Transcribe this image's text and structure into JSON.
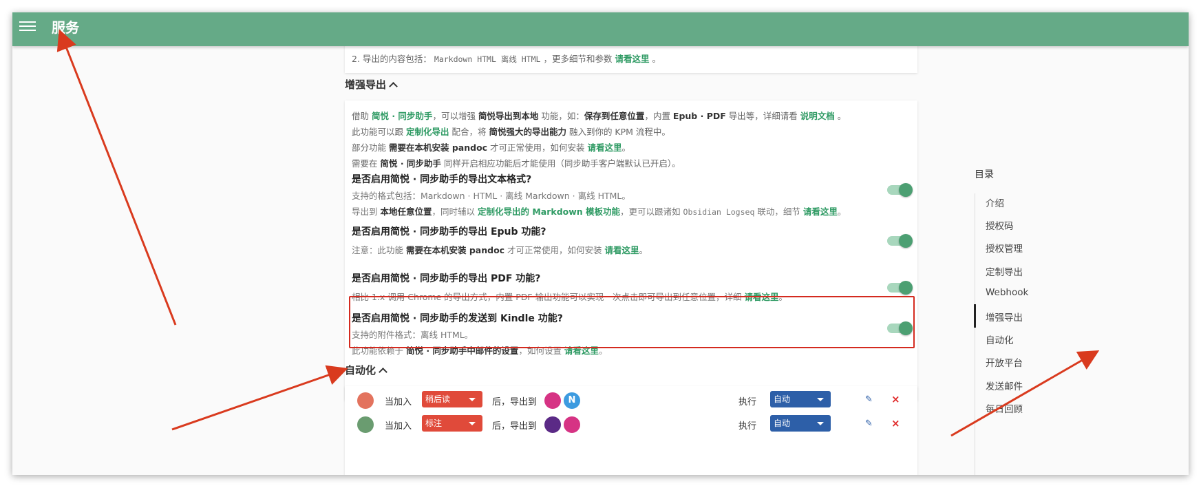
{
  "appbar": {
    "title": "服务"
  },
  "top_card": {
    "line": {
      "prefix": "2. 导出的内容包括：",
      "code": "Markdown HTML 离线 HTML",
      "mid": "，更多细节和参数",
      "link": "请看这里",
      "end": "。"
    }
  },
  "enhanced_export": {
    "heading": "增强导出",
    "notes": [
      {
        "a": "借助 ",
        "l1": "简悦 · 同步助手",
        "b": "，可以增强 ",
        "k1": "简悦导出到本地",
        "c": " 功能，如：",
        "k2": "保存到任意位置",
        "d": "，内置 ",
        "k3": "Epub · PDF",
        "e": " 导出等，详细请看 ",
        "l2": "说明文档",
        "f": " 。"
      },
      {
        "a": "此功能可以跟 ",
        "l1": "定制化导出",
        "b": " 配合，将 ",
        "k1": "简悦强大的导出能力",
        "c": " 融入到你的 KPM 流程中。"
      },
      {
        "a": "部分功能 ",
        "k1": "需要在本机安装 pandoc",
        "b": " 才可正常使用，如何安装 ",
        "l1": "请看这里",
        "c": "。"
      },
      {
        "a": "需要在 ",
        "k1": "简悦 · 同步助手",
        "b": " 同样开启相应功能后才能使用（同步助手客户端默认已开启）。"
      }
    ],
    "options": [
      {
        "title": "是否启用简悦 · 同步助手的导出文本格式?",
        "desc1": "支持的格式包括：Markdown · HTML · 离线 Markdown · 离线 HTML。",
        "desc2": {
          "a": "导出到 ",
          "k1": "本地任意位置",
          "b": "，同时辅以 ",
          "l1": "定制化导出的 Markdown 模板功能",
          "c": "，更可以跟诸如 ",
          "code": "Obsidian Logseq",
          "d": " 联动，细节 ",
          "l2": "请看这里",
          "e": "。"
        },
        "enabled": true
      },
      {
        "title": "是否启用简悦 · 同步助手的导出 Epub 功能?",
        "desc": {
          "a": "注意：此功能 ",
          "k1": "需要在本机安装 pandoc",
          "b": " 才可正常使用，如何安装 ",
          "l1": "请看这里",
          "c": "。"
        },
        "enabled": true
      },
      {
        "title": "是否启用简悦 · 同步助手的导出 PDF 功能?",
        "desc": {
          "a": "相比 1.x 调用 Chrome 的导出方式，内置 PDF 输出功能可以实现一次点击即可导出到任意位置，详细 ",
          "l1": "请看这里",
          "b": "。"
        },
        "enabled": true
      },
      {
        "title": "是否启用简悦 · 同步助手的发送到 Kindle 功能?",
        "desc1": "支持的附件格式：离线 HTML。",
        "desc2": {
          "a": "此功能依赖于 ",
          "k1": "简悦 · 同步助手中邮件的设置",
          "b": "，如何设置 ",
          "l1": "请看这里",
          "c": "。"
        },
        "enabled": true
      }
    ]
  },
  "automation": {
    "heading": "自动化",
    "rows": [
      {
        "when": "当加入",
        "trigger": "稍后读",
        "after": "后，导出到",
        "exec": "执行",
        "mode": "自动",
        "icon_color": "#e3735e",
        "trigger_color": "#e04a3a",
        "services": [
          {
            "label": "",
            "color": "#d63384"
          },
          {
            "label": "N",
            "color": "#3d9be0"
          }
        ]
      },
      {
        "when": "当加入",
        "trigger": "标注",
        "after": "后，导出到",
        "exec": "执行",
        "mode": "自动",
        "icon_color": "#6a9c70",
        "trigger_color": "#e04a3a",
        "services": [
          {
            "label": "",
            "color": "#5b2a86"
          },
          {
            "label": "",
            "color": "#d63384"
          }
        ]
      }
    ]
  },
  "toc": {
    "title": "目录",
    "items": [
      "介绍",
      "授权码",
      "授权管理",
      "定制导出",
      "Webhook",
      "增强导出",
      "自动化",
      "开放平台",
      "发送邮件",
      "每日回顾"
    ],
    "active": "增强导出"
  },
  "colors": {
    "appbar": "#65aa87",
    "link": "#2e9a63",
    "toggle_knob": "#4c9f72",
    "highlight_box": "#d42a1f",
    "annotation_arrow": "#d93a1e"
  }
}
